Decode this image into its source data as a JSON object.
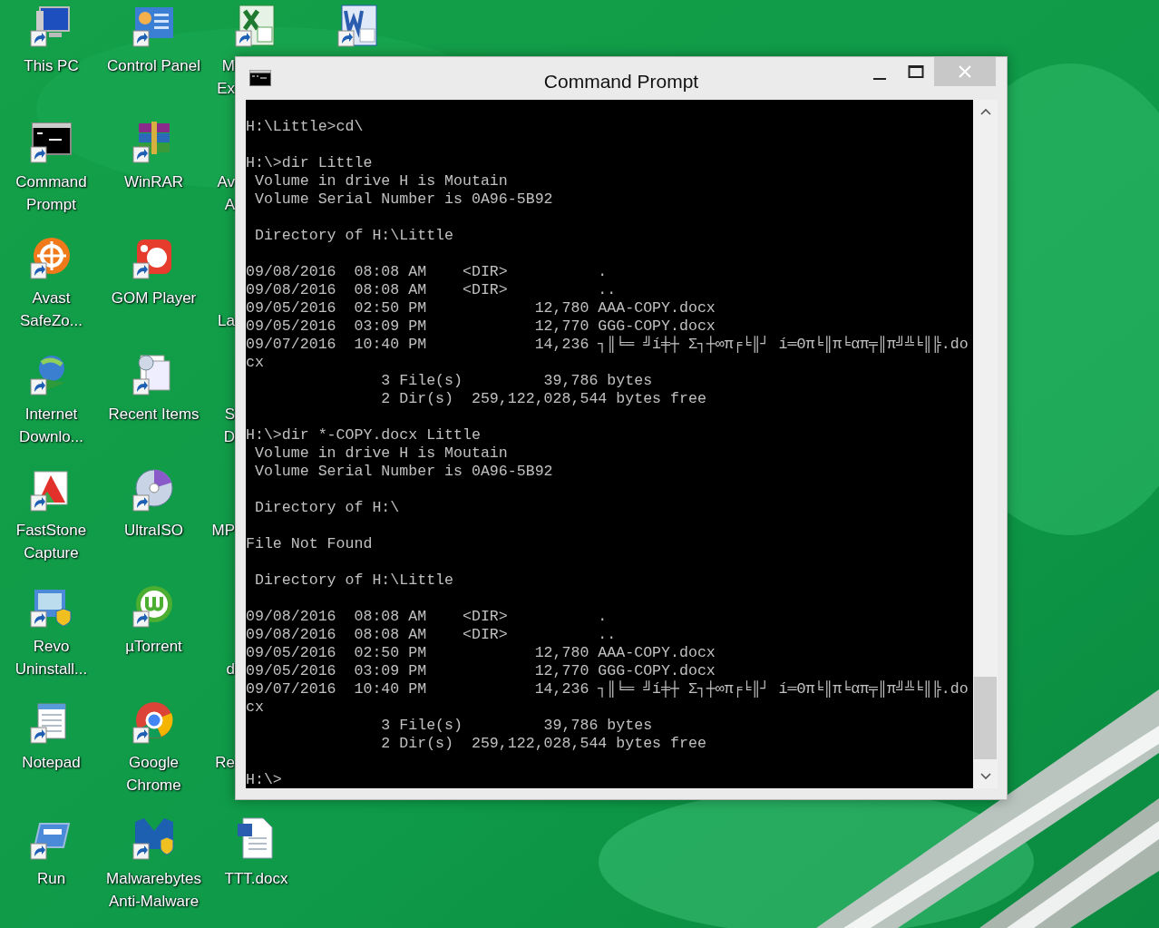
{
  "desktop": {
    "columns": [
      [
        {
          "kind": "computer",
          "label": [
            "This PC"
          ]
        },
        {
          "kind": "terminal",
          "label": [
            "Command",
            "Prompt"
          ]
        },
        {
          "kind": "orange-wheel",
          "label": [
            "Avast",
            "SafeZo..."
          ]
        },
        {
          "kind": "globe-arrow",
          "label": [
            "Internet",
            "Downlo..."
          ]
        },
        {
          "kind": "capture",
          "label": [
            "FastStone",
            "Capture"
          ]
        },
        {
          "kind": "uninstall",
          "label": [
            "Revo",
            "Uninstall..."
          ]
        },
        {
          "kind": "notepad",
          "label": [
            "Notepad"
          ]
        },
        {
          "kind": "run",
          "label": [
            "Run"
          ]
        }
      ],
      [
        {
          "kind": "control-panel",
          "label": [
            "Control Panel"
          ]
        },
        {
          "kind": "archive",
          "label": [
            "WinRAR"
          ]
        },
        {
          "kind": "media-player",
          "label": [
            "GOM Player"
          ]
        },
        {
          "kind": "recent",
          "label": [
            "Recent Items"
          ]
        },
        {
          "kind": "disc",
          "label": [
            "UltraISO"
          ]
        },
        {
          "kind": "torrent",
          "label": [
            "µTorrent"
          ]
        },
        {
          "kind": "browser",
          "label": [
            "Google",
            "Chrome"
          ]
        },
        {
          "kind": "malware",
          "label": [
            "Malwarebytes",
            "Anti-Malware"
          ]
        }
      ],
      [
        {
          "kind": "spreadsheet",
          "label": [
            "M",
            "Ex"
          ],
          "cut_by_window": true
        },
        {
          "label": [
            "Av",
            "A"
          ],
          "cut_by_window": true
        },
        {
          "label": [
            "La"
          ],
          "first_line_hidden": true,
          "cut_by_window": true
        },
        {
          "label": [
            "S",
            "D"
          ],
          "cut_by_window": true
        },
        {
          "label": [
            "MP"
          ],
          "cut_by_window": true
        },
        {
          "label": [
            "d"
          ],
          "first_line_hidden": true,
          "cut_by_window": true
        },
        {
          "label": [
            "Re"
          ],
          "cut_by_window": true
        },
        {
          "kind": "docx",
          "label": [
            "TTT.docx"
          ]
        }
      ],
      [
        {
          "kind": "word"
        }
      ]
    ]
  },
  "window": {
    "title": "Command Prompt",
    "console": {
      "blocks": [
        [
          "H:\\Little>cd\\"
        ],
        [
          "H:\\>dir Little",
          " Volume in drive H is Moutain",
          " Volume Serial Number is 0A96-5B92"
        ],
        [
          " Directory of H:\\Little"
        ],
        [
          "09/08/2016  08:08 AM    <DIR>          .",
          "09/08/2016  08:08 AM    <DIR>          ..",
          "09/05/2016  02:50 PM            12,780 AAA-COPY.docx",
          "09/05/2016  03:09 PM            12,770 GGG-COPY.docx",
          "09/07/2016  10:40 PM            14,236 ┐║╘═ ╝í╪┼ Σ┐┼∞π╒╘║┘ í═Θπ╘║π╘απ╤║π╝╩╘║╠.do",
          "cx",
          "               3 File(s)         39,786 bytes",
          "               2 Dir(s)  259,122,028,544 bytes free"
        ],
        [
          "H:\\>dir *-COPY.docx Little",
          " Volume in drive H is Moutain",
          " Volume Serial Number is 0A96-5B92"
        ],
        [
          " Directory of H:\\"
        ],
        [
          "File Not Found"
        ],
        [
          " Directory of H:\\Little"
        ],
        [
          "09/08/2016  08:08 AM    <DIR>          .",
          "09/08/2016  08:08 AM    <DIR>          ..",
          "09/05/2016  02:50 PM            12,780 AAA-COPY.docx",
          "09/05/2016  03:09 PM            12,770 GGG-COPY.docx",
          "09/07/2016  10:40 PM            14,236 ┐║╘═ ╝í╪┼ Σ┐┼∞π╒╘║┘ í═Θπ╘║π╘απ╤║π╝╩╘║╠.do",
          "cx",
          "               3 File(s)         39,786 bytes",
          "               2 Dir(s)  259,122,028,544 bytes free"
        ],
        [
          "H:\\>"
        ]
      ]
    }
  }
}
